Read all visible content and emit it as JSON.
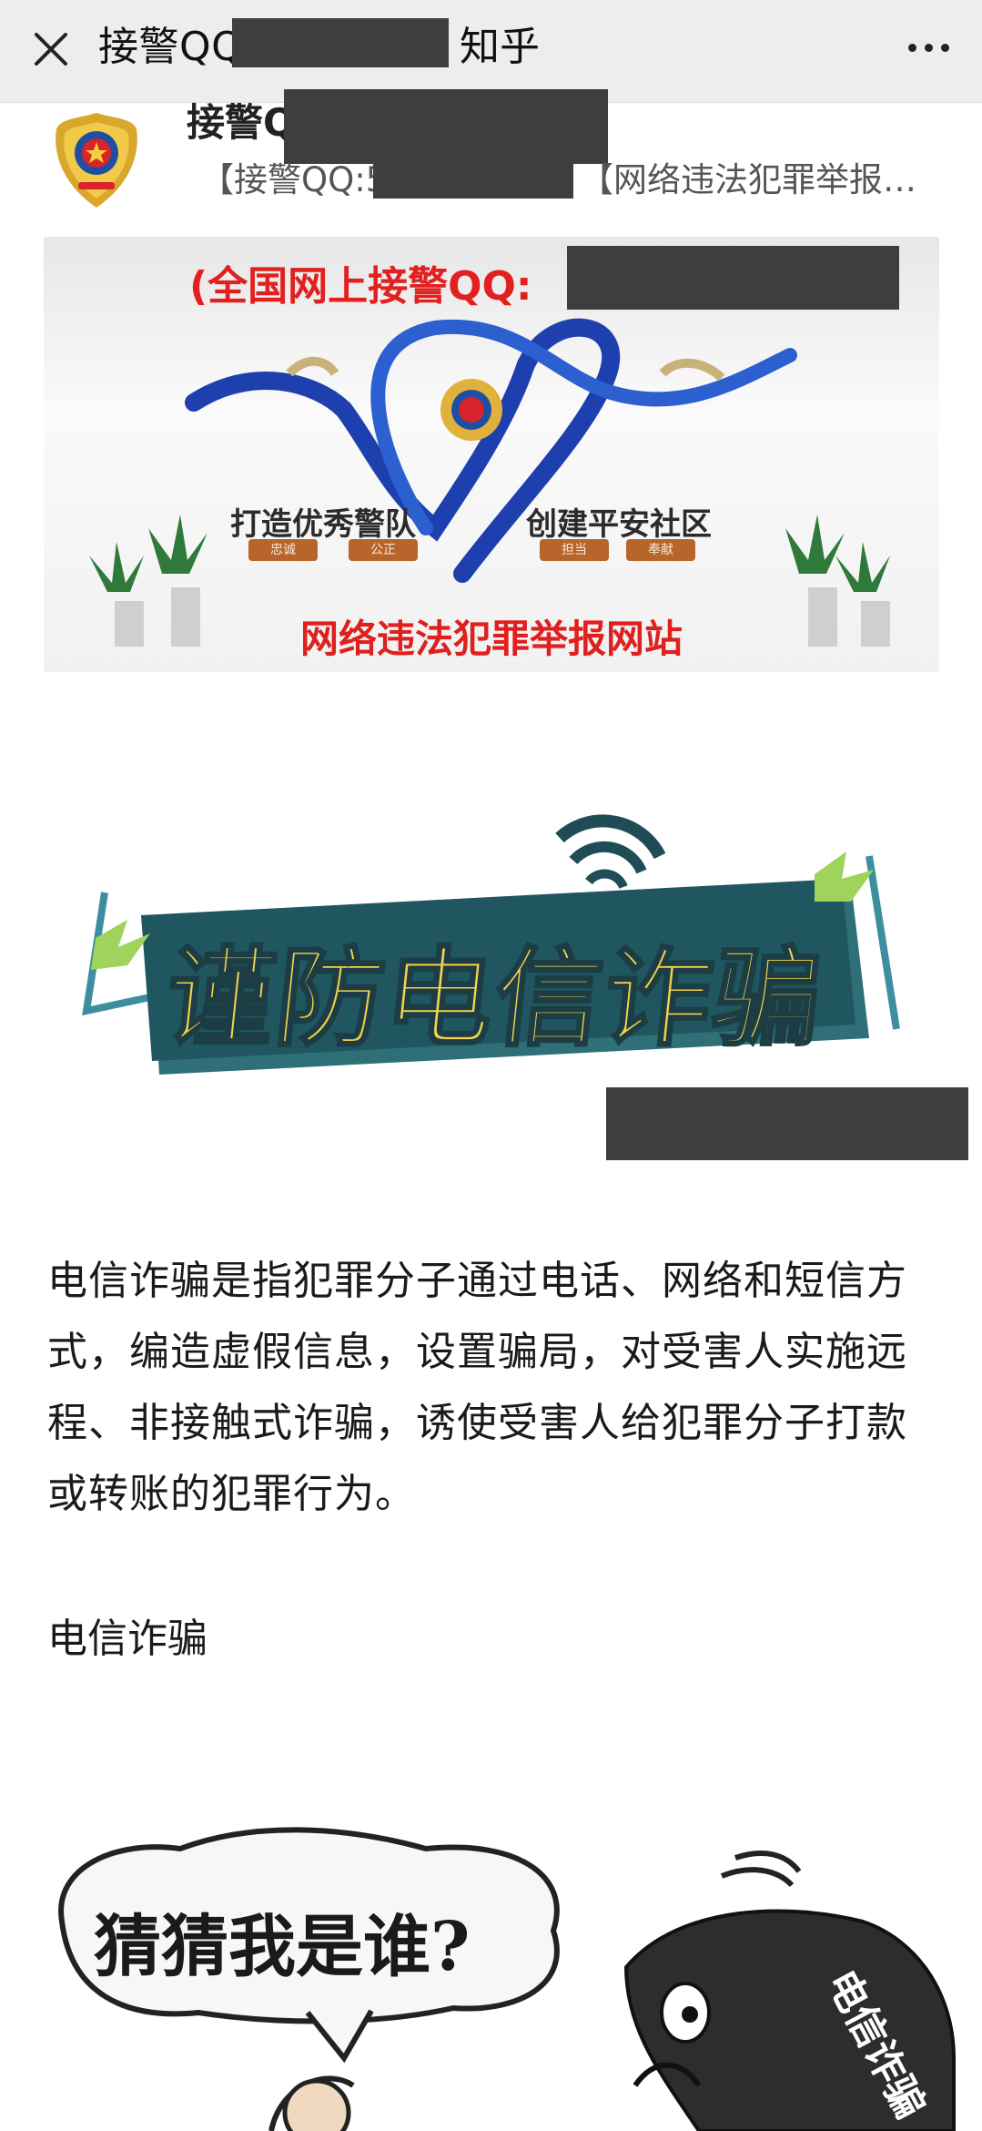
{
  "header": {
    "title_prefix": "接警QQ",
    "title_suffix": "知乎",
    "close_icon": "close-icon",
    "more_icon": "more-icon"
  },
  "author": {
    "name": "接警Q",
    "subtitle_prefix": "【接警QQ:5",
    "subtitle_suffix": "【网络违法犯罪举报…"
  },
  "banner": {
    "title": "(全国网上接警QQ:",
    "slogan_left": "打造优秀警队",
    "slogan_right": "创建平安社区",
    "tags": [
      "忠诚",
      "公正",
      "担当",
      "奉献"
    ],
    "site": "网络违法犯罪举报网站"
  },
  "beware_graphic": {
    "text": "谨防电信诈骗"
  },
  "article": {
    "paragraph": "电信诈骗是指犯罪分子通过电话、网络和短信方式，编造虚假信息，设置骗局，对受害人实施远程、非接触式诈骗，诱使受害人给犯罪分子打款或转账的犯罪行为。",
    "subheading": "电信诈骗"
  },
  "cartoon": {
    "bubble_text": "猜猜我是谁?",
    "phone_text": "电信诈骗"
  },
  "colors": {
    "topbar": "#ededed",
    "red": "#e22020",
    "redact": "#3e3e3e",
    "yellow": "#f5d34a",
    "teal": "#2f6f78"
  }
}
